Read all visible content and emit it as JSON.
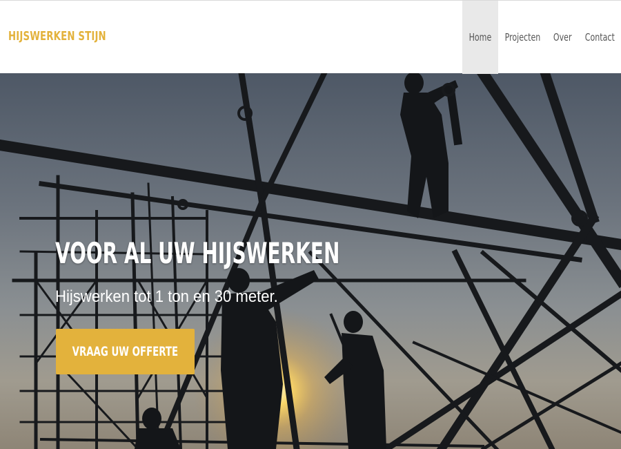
{
  "brand": {
    "name": "HIJSWERKEN STIJN",
    "color": "#e3b23c"
  },
  "nav": {
    "items": [
      {
        "label": "Home",
        "active": true
      },
      {
        "label": "Projecten",
        "active": false
      },
      {
        "label": "Over",
        "active": false
      },
      {
        "label": "Contact",
        "active": false
      }
    ]
  },
  "hero": {
    "title": "VOOR AL UW HIJSWERKEN",
    "subtitle": "Hijswerken tot 1 ton en 30 meter.",
    "cta_label": "VRAAG UW OFFERTE",
    "cta_color": "#e3b23c"
  }
}
